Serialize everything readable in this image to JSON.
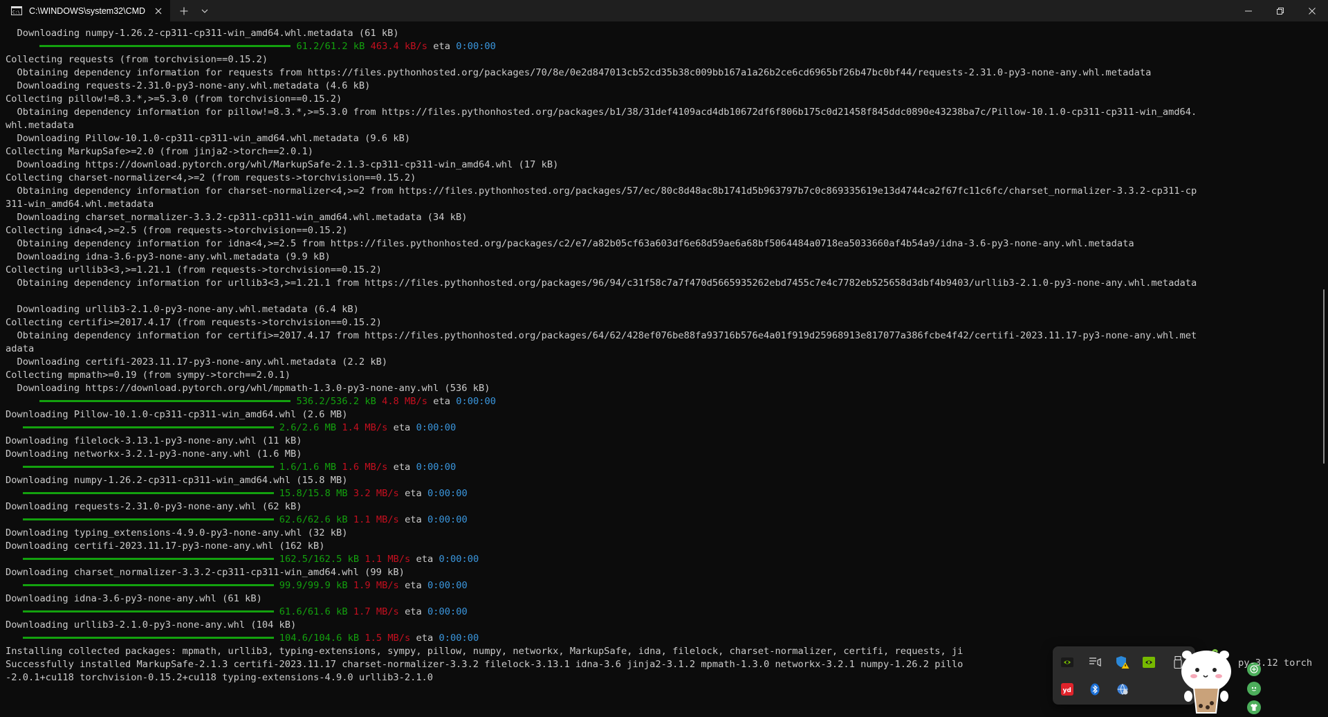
{
  "titlebar": {
    "tab_title": "C:\\WINDOWS\\system32\\CMD",
    "icons": [
      "terminal-icon",
      "close-icon",
      "plus-icon",
      "chevron-down-icon",
      "minimize-icon",
      "restore-icon",
      "window-close-icon"
    ]
  },
  "colors": {
    "background": "#0c0c0c",
    "text": "#cccccc",
    "green": "#13a10e",
    "red": "#c50f1f",
    "blue": "#3a96dd"
  },
  "lines": [
    {
      "t": "  Downloading numpy-1.26.2-cp311-cp311-win_amd64.whl.metadata (61 kB)"
    },
    {
      "progress": 1,
      "ind": "      ",
      "done": "61.2/61.2 kB",
      "rate": "463.4 kB/s",
      "eta_label": "eta",
      "eta": "0:00:00"
    },
    {
      "t": "Collecting requests (from torchvision==0.15.2)"
    },
    {
      "t": "  Obtaining dependency information for requests from https://files.pythonhosted.org/packages/70/8e/0e2d847013cb52cd35b38c009bb167a1a26b2ce6cd6965bf26b47bc0bf44/requests-2.31.0-py3-none-any.whl.metadata"
    },
    {
      "t": "  Downloading requests-2.31.0-py3-none-any.whl.metadata (4.6 kB)"
    },
    {
      "t": "Collecting pillow!=8.3.*,>=5.3.0 (from torchvision==0.15.2)"
    },
    {
      "t": "  Obtaining dependency information for pillow!=8.3.*,>=5.3.0 from https://files.pythonhosted.org/packages/b1/38/31def4109acd4db10672df6f806b175c0d21458f845ddc0890e43238ba7c/Pillow-10.1.0-cp311-cp311-win_amd64."
    },
    {
      "t": "whl.metadata"
    },
    {
      "t": "  Downloading Pillow-10.1.0-cp311-cp311-win_amd64.whl.metadata (9.6 kB)"
    },
    {
      "t": "Collecting MarkupSafe>=2.0 (from jinja2->torch==2.0.1)"
    },
    {
      "t": "  Downloading https://download.pytorch.org/whl/MarkupSafe-2.1.3-cp311-cp311-win_amd64.whl (17 kB)"
    },
    {
      "t": "Collecting charset-normalizer<4,>=2 (from requests->torchvision==0.15.2)"
    },
    {
      "t": "  Obtaining dependency information for charset-normalizer<4,>=2 from https://files.pythonhosted.org/packages/57/ec/80c8d48ac8b1741d5b963797b7c0c869335619e13d4744ca2f67fc11c6fc/charset_normalizer-3.3.2-cp311-cp"
    },
    {
      "t": "311-win_amd64.whl.metadata"
    },
    {
      "t": "  Downloading charset_normalizer-3.3.2-cp311-cp311-win_amd64.whl.metadata (34 kB)"
    },
    {
      "t": "Collecting idna<4,>=2.5 (from requests->torchvision==0.15.2)"
    },
    {
      "t": "  Obtaining dependency information for idna<4,>=2.5 from https://files.pythonhosted.org/packages/c2/e7/a82b05cf63a603df6e68d59ae6a68bf5064484a0718ea5033660af4b54a9/idna-3.6-py3-none-any.whl.metadata"
    },
    {
      "t": "  Downloading idna-3.6-py3-none-any.whl.metadata (9.9 kB)"
    },
    {
      "t": "Collecting urllib3<3,>=1.21.1 (from requests->torchvision==0.15.2)"
    },
    {
      "t": "  Obtaining dependency information for urllib3<3,>=1.21.1 from https://files.pythonhosted.org/packages/96/94/c31f58c7a7f470d5665935262ebd7455c7e4c7782eb525658d3dbf4b9403/urllib3-2.1.0-py3-none-any.whl.metadata"
    },
    {
      "t": ""
    },
    {
      "t": "  Downloading urllib3-2.1.0-py3-none-any.whl.metadata (6.4 kB)"
    },
    {
      "t": "Collecting certifi>=2017.4.17 (from requests->torchvision==0.15.2)"
    },
    {
      "t": "  Obtaining dependency information for certifi>=2017.4.17 from https://files.pythonhosted.org/packages/64/62/428ef076be88fa93716b576e4a01f919d25968913e817077a386fcbe4f42/certifi-2023.11.17-py3-none-any.whl.met"
    },
    {
      "t": "adata"
    },
    {
      "t": "  Downloading certifi-2023.11.17-py3-none-any.whl.metadata (2.2 kB)"
    },
    {
      "t": "Collecting mpmath>=0.19 (from sympy->torch==2.0.1)"
    },
    {
      "t": "  Downloading https://download.pytorch.org/whl/mpmath-1.3.0-py3-none-any.whl (536 kB)"
    },
    {
      "progress": 1,
      "ind": "      ",
      "done": "536.2/536.2 kB",
      "rate": "4.8 MB/s",
      "eta_label": "eta",
      "eta": "0:00:00"
    },
    {
      "t": "Downloading Pillow-10.1.0-cp311-cp311-win_amd64.whl (2.6 MB)"
    },
    {
      "progress": 1,
      "ind": "   ",
      "done": "2.6/2.6 MB",
      "rate": "1.4 MB/s",
      "eta_label": "eta",
      "eta": "0:00:00"
    },
    {
      "t": "Downloading filelock-3.13.1-py3-none-any.whl (11 kB)"
    },
    {
      "t": "Downloading networkx-3.2.1-py3-none-any.whl (1.6 MB)"
    },
    {
      "progress": 1,
      "ind": "   ",
      "done": "1.6/1.6 MB",
      "rate": "1.6 MB/s",
      "eta_label": "eta",
      "eta": "0:00:00"
    },
    {
      "t": "Downloading numpy-1.26.2-cp311-cp311-win_amd64.whl (15.8 MB)"
    },
    {
      "progress": 1,
      "ind": "   ",
      "done": "15.8/15.8 MB",
      "rate": "3.2 MB/s",
      "eta_label": "eta",
      "eta": "0:00:00"
    },
    {
      "t": "Downloading requests-2.31.0-py3-none-any.whl (62 kB)"
    },
    {
      "progress": 1,
      "ind": "   ",
      "done": "62.6/62.6 kB",
      "rate": "1.1 MB/s",
      "eta_label": "eta",
      "eta": "0:00:00"
    },
    {
      "t": "Downloading typing_extensions-4.9.0-py3-none-any.whl (32 kB)"
    },
    {
      "t": "Downloading certifi-2023.11.17-py3-none-any.whl (162 kB)"
    },
    {
      "progress": 1,
      "ind": "   ",
      "done": "162.5/162.5 kB",
      "rate": "1.1 MB/s",
      "eta_label": "eta",
      "eta": "0:00:00"
    },
    {
      "t": "Downloading charset_normalizer-3.3.2-cp311-cp311-win_amd64.whl (99 kB)"
    },
    {
      "progress": 1,
      "ind": "   ",
      "done": "99.9/99.9 kB",
      "rate": "1.9 MB/s",
      "eta_label": "eta",
      "eta": "0:00:00"
    },
    {
      "t": "Downloading idna-3.6-py3-none-any.whl (61 kB)"
    },
    {
      "progress": 1,
      "ind": "   ",
      "done": "61.6/61.6 kB",
      "rate": "1.7 MB/s",
      "eta_label": "eta",
      "eta": "0:00:00"
    },
    {
      "t": "Downloading urllib3-2.1.0-py3-none-any.whl (104 kB)"
    },
    {
      "progress": 1,
      "ind": "   ",
      "done": "104.6/104.6 kB",
      "rate": "1.5 MB/s",
      "eta_label": "eta",
      "eta": "0:00:00"
    },
    {
      "t": "Installing collected packages: mpmath, urllib3, typing-extensions, sympy, pillow, numpy, networkx, MarkupSafe, idna, filelock, charset-normalizer, certifi, requests, ji"
    },
    {
      "t": "Successfully installed MarkupSafe-2.1.3 certifi-2023.11.17 charset-normalizer-3.3.2 filelock-3.13.1 idna-3.6 jinja2-3.1.2 mpmath-1.3.0 networkx-3.2.1 numpy-1.26.2 pillo"
    },
    {
      "t": "-2.0.1+cu118 torchvision-0.15.2+cu118 typing-extensions-4.9.0 urllib3-2.1.0"
    }
  ],
  "overlay_text": {
    "line51_tail": "py-3.12 torch"
  },
  "tray": {
    "icons": [
      "nvidia-icon",
      "audio-device-icon",
      "windows-security-warning-icon",
      "nvidia-geforce-icon",
      "usb-drive-icon",
      "youdao-icon",
      "bluetooth-icon",
      "network-globe-icon"
    ]
  },
  "floating": {
    "mascot": "bubble-tea-bear-mascot",
    "buttons": [
      "add-icon",
      "face-icon",
      "shirt-icon"
    ]
  }
}
